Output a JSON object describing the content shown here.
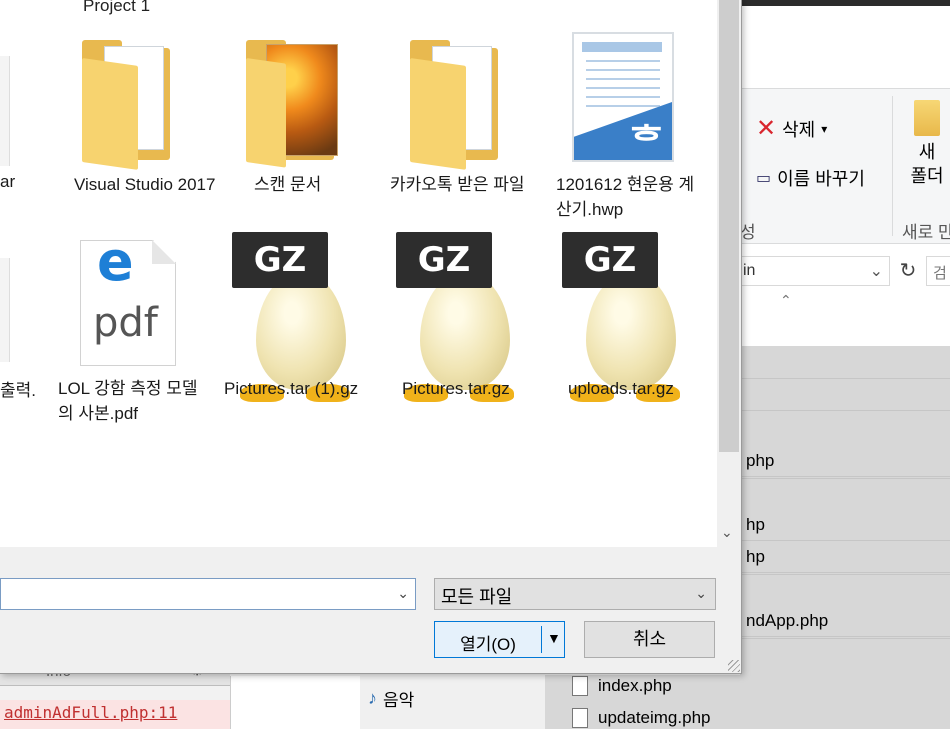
{
  "bg_explorer": {
    "ribbon": {
      "delete_label": "삭제",
      "rename_label": "이름 바꾸기",
      "group_left_label": "성",
      "new_folder_label_1": "새",
      "new_folder_label_2": "폴더",
      "group_right_label": "새로 만"
    },
    "address_text": "in",
    "search_text": "검",
    "files": [
      {
        "name": "php"
      },
      {
        "name": "hp"
      },
      {
        "name": "hp"
      },
      {
        "name": "ndApp.php"
      },
      {
        "name": "index.php"
      },
      {
        "name": "updateimg.php"
      }
    ]
  },
  "bg_sidebar": {
    "music_label": "음악"
  },
  "bg_editor": {
    "tab_label": "Info",
    "error_line": "adminAdFull.php:11"
  },
  "dialog": {
    "breadcrumb": "Project 1",
    "items": [
      {
        "label": "Visual Studio 2017"
      },
      {
        "label": "스캔 문서"
      },
      {
        "label": "카카오톡 받은 파일"
      },
      {
        "label": "1201612 현운용 계산기.hwp"
      },
      {
        "label": "LOL 강함 측정 모델의 사본.pdf"
      },
      {
        "label": "Pictures.tar (1).gz"
      },
      {
        "label": "Pictures.tar.gz"
      },
      {
        "label": "uploads.tar.gz"
      }
    ],
    "partial_left_1": "ar",
    "partial_left_2": "출력.",
    "gz_badge": "GZ",
    "hwp_glyph": "ᄒ",
    "pdf_glyph": "e",
    "pdf_text": "pdf",
    "filename_value": "",
    "filter_value": "모든 파일",
    "open_button": "열기(O)",
    "cancel_button": "취소"
  }
}
